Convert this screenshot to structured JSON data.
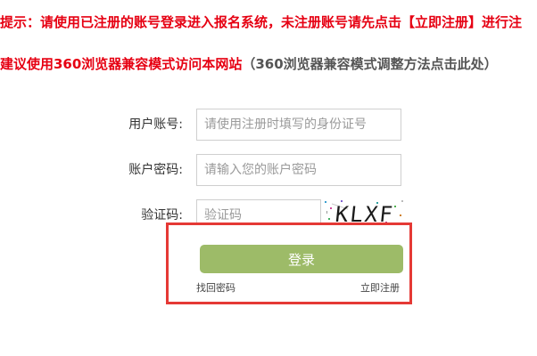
{
  "notices": {
    "line1": "提示：请使用已注册的账号登录进入报名系统，未注册账号请先点击【立即注册】进行注",
    "line2_red": "建议使用360浏览器兼容模式访问本网站",
    "line2_gray": "（360浏览器兼容模式调整方法点击此处）"
  },
  "form": {
    "account_label": "用户账号:",
    "account_placeholder": "请使用注册时填写的身份证号",
    "password_label": "账户密码:",
    "password_placeholder": "请输入您的账户密码",
    "captcha_label": "验证码:",
    "captcha_placeholder": "验证码",
    "captcha_text": "KLXF"
  },
  "actions": {
    "login_label": "登录",
    "forgot_password": "找回密码",
    "register_now": "立即注册"
  },
  "colors": {
    "notice_red": "#e60012",
    "button_green": "#9dbb68",
    "highlight_border": "#e53935"
  }
}
